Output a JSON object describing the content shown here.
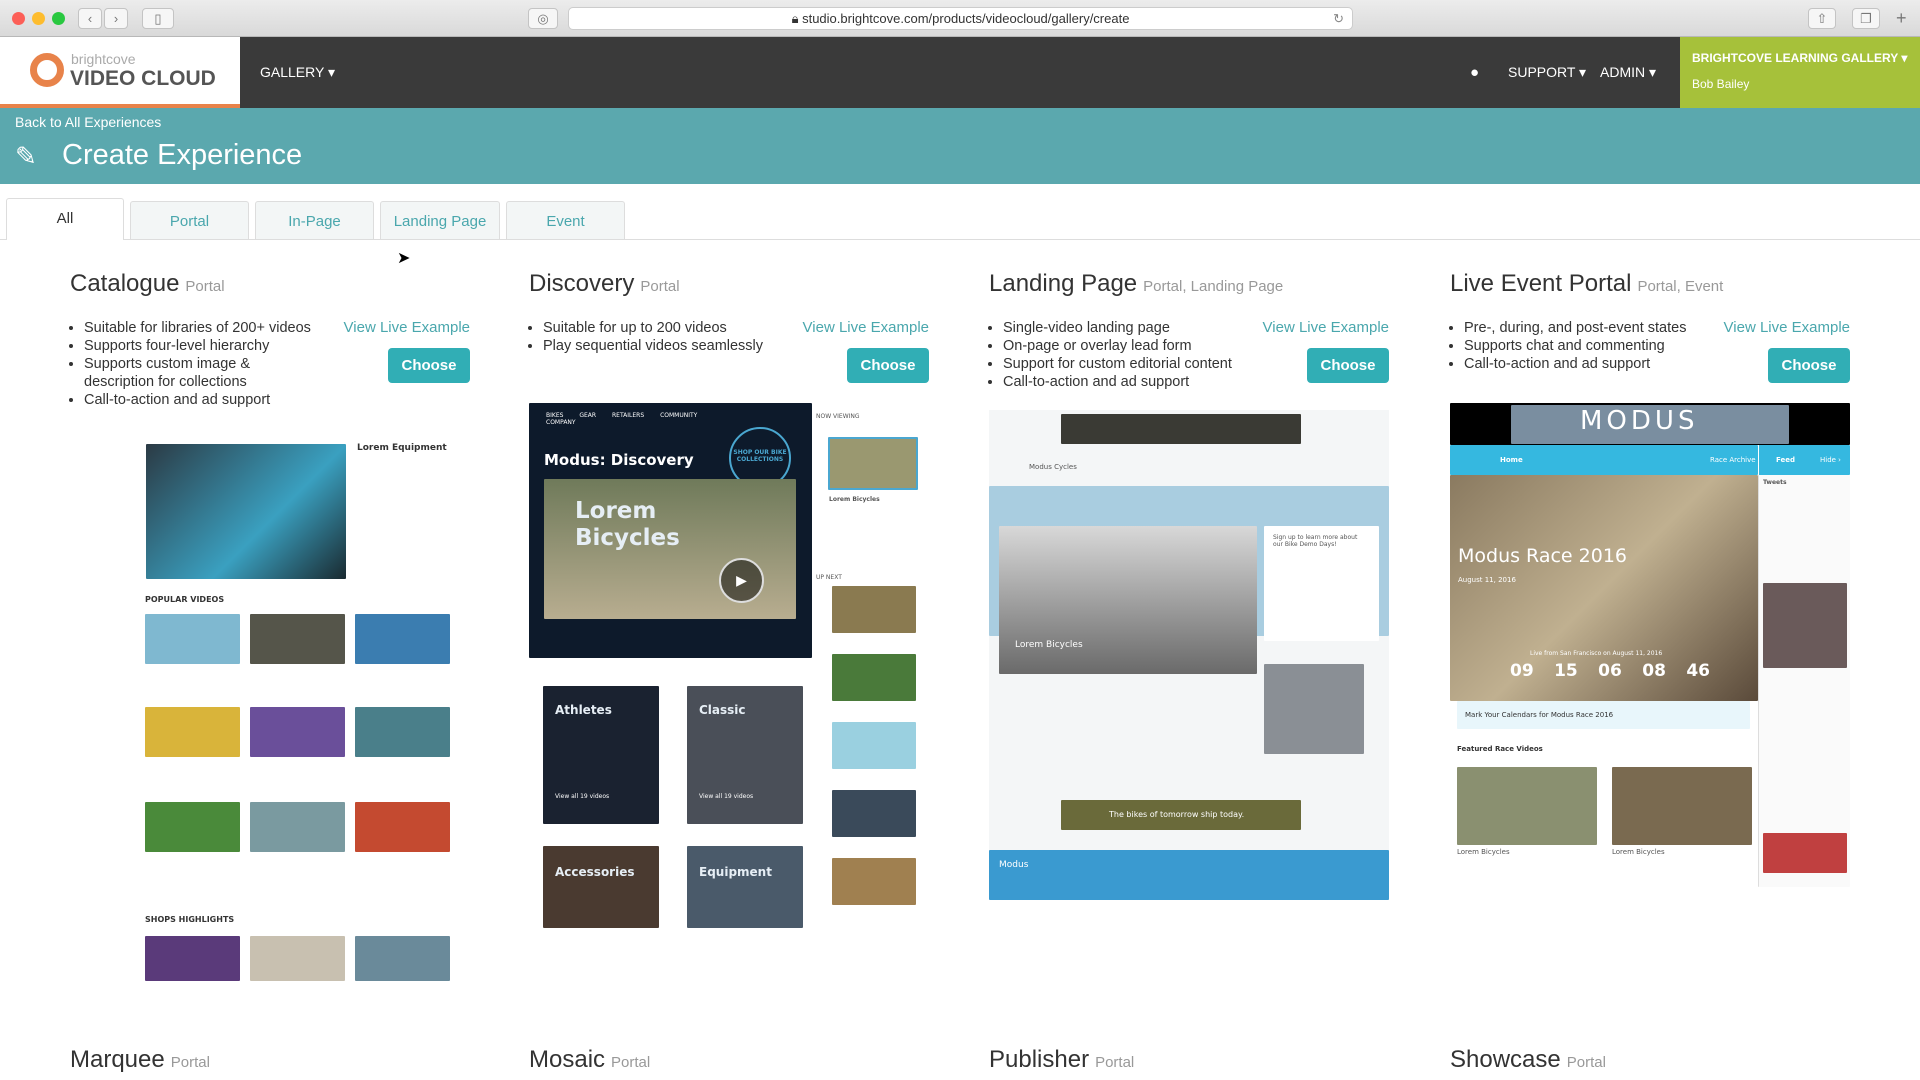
{
  "browser": {
    "url": "studio.brightcove.com/products/videocloud/gallery/create"
  },
  "nav": {
    "logo_top": "brightcove",
    "logo_bottom": "VIDEO CLOUD",
    "gallery": "GALLERY ▾",
    "support": "SUPPORT ▾",
    "admin": "ADMIN ▾",
    "account": "BRIGHTCOVE LEARNING GALLERY ▾",
    "user": "Bob Bailey"
  },
  "header": {
    "back": "Back to All Experiences",
    "title": "Create Experience"
  },
  "tabs": [
    "All",
    "Portal",
    "In-Page",
    "Landing Page",
    "Event"
  ],
  "common": {
    "view": "View Live Example",
    "choose": "Choose"
  },
  "experiences": [
    {
      "title": "Catalogue",
      "type": "Portal",
      "bullets": [
        "Suitable for libraries of 200+ videos",
        "Supports four-level hierarchy",
        "Supports custom image & description for collections",
        "Call-to-action and ad support"
      ]
    },
    {
      "title": "Discovery",
      "type": "Portal",
      "bullets": [
        "Suitable for up to 200 videos",
        "Play sequential videos seamlessly"
      ]
    },
    {
      "title": "Landing Page",
      "type": "Portal, Landing Page",
      "bullets": [
        "Single-video landing page",
        "On-page or overlay lead form",
        "Support for custom editorial content",
        "Call-to-action and ad support"
      ]
    },
    {
      "title": "Live Event Portal",
      "type": "Portal, Event",
      "bullets": [
        "Pre-, during, and post-event states",
        "Supports chat and commenting",
        "Call-to-action and ad support"
      ]
    }
  ],
  "more": [
    {
      "title": "Marquee",
      "type": "Portal"
    },
    {
      "title": "Mosaic",
      "type": "Portal"
    },
    {
      "title": "Publisher",
      "type": "Portal"
    },
    {
      "title": "Showcase",
      "type": "Portal"
    }
  ],
  "previews": {
    "catalogue": {
      "product": "Lorem Equipment",
      "popular": "POPULAR VIDEOS",
      "shops": "SHOPS HIGHLIGHTS"
    },
    "discovery": {
      "nav": [
        "BIKES",
        "GEAR",
        "RETAILERS",
        "COMMUNITY",
        "COMPANY"
      ],
      "title": "Modus: Discovery",
      "hero": "Lorem Bicycles",
      "shop": "SHOP OUR BIKE COLLECTIONS",
      "now": "NOW VIEWING",
      "upnext": "UP NEXT",
      "item": "Lorem Bicycles",
      "cats": [
        "Athletes",
        "Classic",
        "Accessories",
        "Equipment"
      ],
      "viewall": "View all 19 videos"
    },
    "landing": {
      "brand": "Modus Cycles",
      "banner": "The bikes of tomorrow ship today.",
      "signup": "Sign up to learn more about our Bike Demo Days!",
      "video": "Lorem Bicycles",
      "footer": "Modus"
    },
    "live": {
      "brand": "MODUS",
      "home": "Home",
      "archive": "Race Archive",
      "feed": "Feed",
      "hide": "Hide ›",
      "title": "Modus Race 2016",
      "date": "August 11, 2016",
      "live": "Live from San Francisco on August 11, 2016",
      "countdown": [
        "09",
        "15",
        "06",
        "08",
        "46"
      ],
      "mark": "Mark Your Calendars for Modus Race 2016",
      "featured": "Featured Race Videos",
      "item": "Lorem Bicycles",
      "tweets": "Tweets"
    }
  }
}
